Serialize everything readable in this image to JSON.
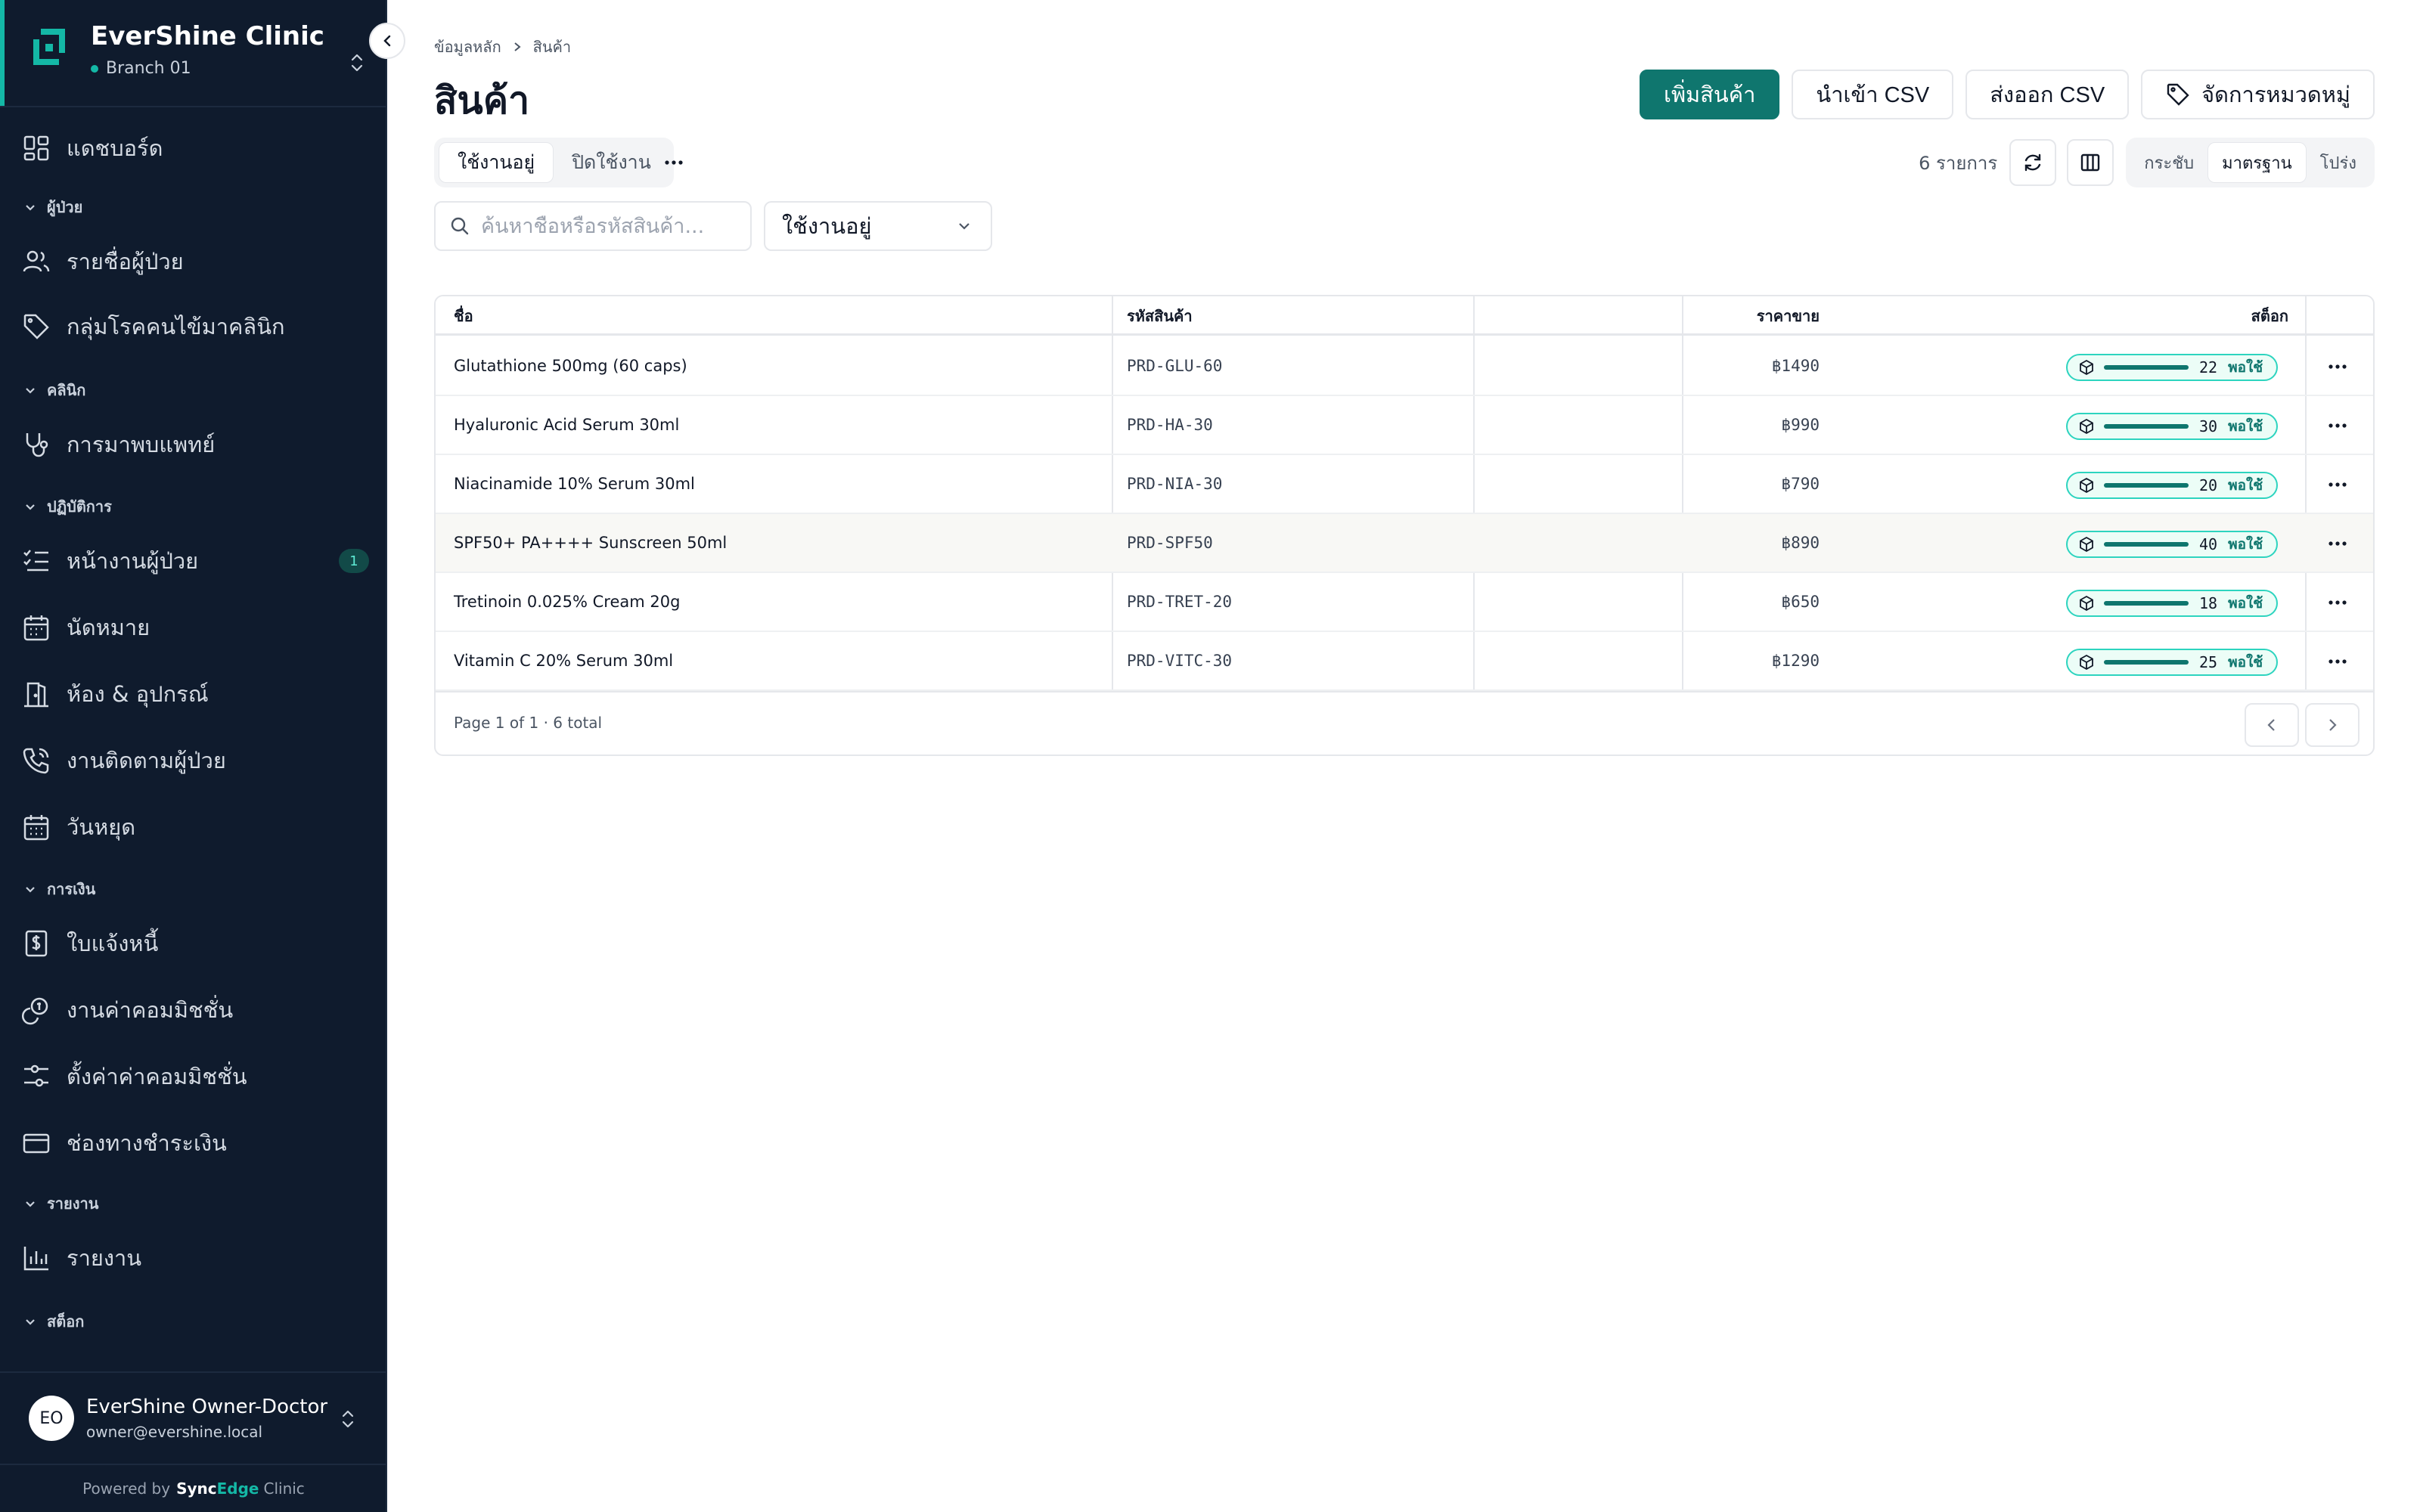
{
  "brand": {
    "name": "EverShine Clinic",
    "branch": "Branch 01"
  },
  "nav": {
    "dashboard": "แดชบอร์ด",
    "section_patients": "ผู้ป่วย",
    "patient_list": "รายชื่อผู้ป่วย",
    "disease_groups": "กลุ่มโรคคนไข้มาคลินิก",
    "section_clinic": "คลินิก",
    "doctor_visits": "การมาพบแพทย์",
    "section_operations": "ปฏิบัติการ",
    "patient_tasks": "หน้างานผู้ป่วย",
    "patient_tasks_badge": "1",
    "appointments": "นัดหมาย",
    "rooms": "ห้อง & อุปกรณ์",
    "followups": "งานติดตามผู้ป่วย",
    "holidays": "วันหยุด",
    "section_finance": "การเงิน",
    "invoices": "ใบแจ้งหนี้",
    "commission_jobs": "งานค่าคอมมิชชั่น",
    "commission_settings": "ตั้งค่าค่าคอมมิชชั่น",
    "payment_channels": "ช่องทางชำระเงิน",
    "section_reports": "รายงาน",
    "reports": "รายงาน",
    "section_stock": "สต็อก"
  },
  "user": {
    "initials": "EO",
    "name": "EverShine Owner-Doctor",
    "email": "owner@evershine.local"
  },
  "footer": {
    "powered_by": "Powered by",
    "sync": "Sync",
    "edge": "Edge",
    "clinic": "Clinic"
  },
  "breadcrumb": {
    "parent": "ข้อมูลหลัก",
    "current": "สินค้า"
  },
  "page": {
    "title": "สินค้า"
  },
  "actions": {
    "add": "เพิ่มสินค้า",
    "import_csv": "นำเข้า CSV",
    "export_csv": "ส่งออก CSV",
    "manage_categories": "จัดการหมวดหมู่"
  },
  "status_tabs": {
    "active": "ใช้งานอยู่",
    "inactive": "ปิดใช้งาน"
  },
  "toolbar": {
    "count": "6 รายการ"
  },
  "density": {
    "compact": "กระชับ",
    "standard": "มาตรฐาน",
    "comfortable": "โปร่ง"
  },
  "search": {
    "placeholder": "ค้นหาชื่อหรือรหัสสินค้า..."
  },
  "filter": {
    "status_value": "ใช้งานอยู่"
  },
  "table": {
    "headers": {
      "name": "ชื่อ",
      "sku": "รหัสสินค้า",
      "price": "ราคาขาย",
      "stock": "สต็อก"
    },
    "stock_label": "พอใช้",
    "rows": [
      {
        "name": "Glutathione 500mg (60 caps)",
        "sku": "PRD-GLU-60",
        "price": "฿1490",
        "stock": "22"
      },
      {
        "name": "Hyaluronic Acid Serum 30ml",
        "sku": "PRD-HA-30",
        "price": "฿990",
        "stock": "30"
      },
      {
        "name": "Niacinamide 10% Serum 30ml",
        "sku": "PRD-NIA-30",
        "price": "฿790",
        "stock": "20"
      },
      {
        "name": "SPF50+ PA++++ Sunscreen 50ml",
        "sku": "PRD-SPF50",
        "price": "฿890",
        "stock": "40"
      },
      {
        "name": "Tretinoin 0.025% Cream 20g",
        "sku": "PRD-TRET-20",
        "price": "฿650",
        "stock": "18"
      },
      {
        "name": "Vitamin C 20% Serum 30ml",
        "sku": "PRD-VITC-30",
        "price": "฿1290",
        "stock": "25"
      }
    ]
  },
  "pagination": {
    "info": "Page 1 of 1 · 6 total"
  },
  "colors": {
    "accent": "#0f766e",
    "sidebar_bg": "#0f1b2d",
    "teal": "#14b8a6"
  }
}
